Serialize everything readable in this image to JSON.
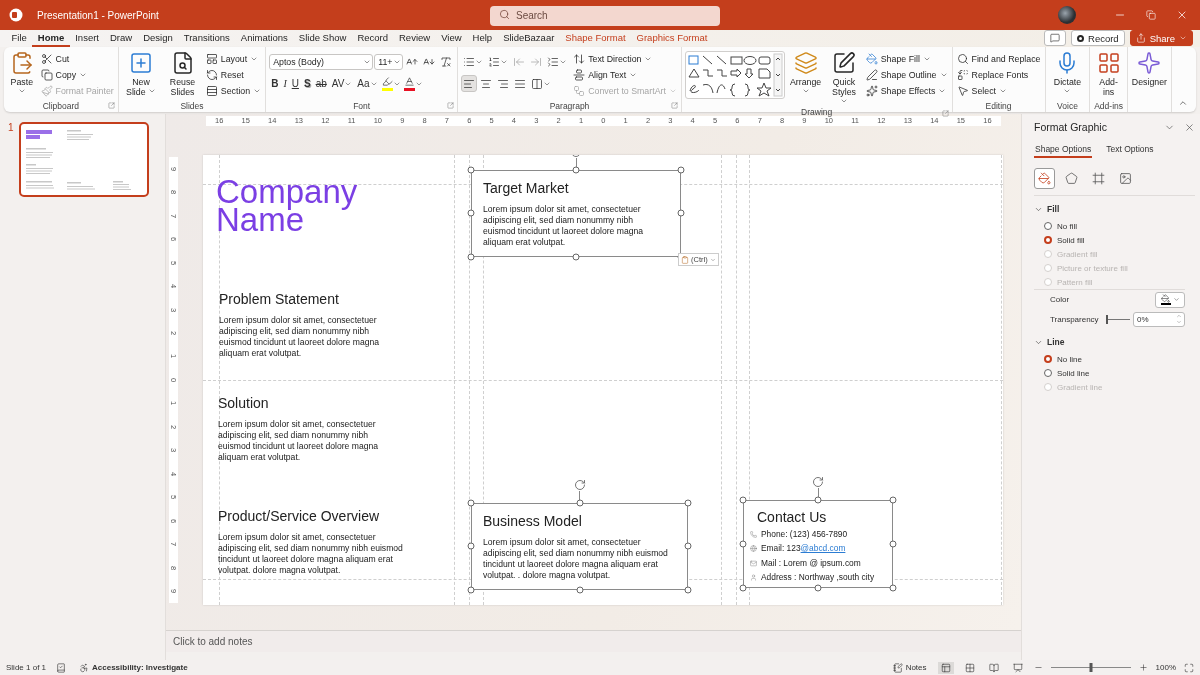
{
  "window": {
    "title": "Presentation1 - PowerPoint",
    "search_placeholder": "Search"
  },
  "ribbon_tabs": [
    {
      "label": "File",
      "selected": false,
      "kind": "normal"
    },
    {
      "label": "Home",
      "selected": true,
      "kind": "normal"
    },
    {
      "label": "Insert",
      "selected": false,
      "kind": "normal"
    },
    {
      "label": "Draw",
      "selected": false,
      "kind": "normal"
    },
    {
      "label": "Design",
      "selected": false,
      "kind": "normal"
    },
    {
      "label": "Transitions",
      "selected": false,
      "kind": "normal"
    },
    {
      "label": "Animations",
      "selected": false,
      "kind": "normal"
    },
    {
      "label": "Slide Show",
      "selected": false,
      "kind": "normal"
    },
    {
      "label": "Record",
      "selected": false,
      "kind": "normal"
    },
    {
      "label": "Review",
      "selected": false,
      "kind": "normal"
    },
    {
      "label": "View",
      "selected": false,
      "kind": "normal"
    },
    {
      "label": "Help",
      "selected": false,
      "kind": "normal"
    },
    {
      "label": "SlideBazaar",
      "selected": false,
      "kind": "normal"
    },
    {
      "label": "Shape Format",
      "selected": false,
      "kind": "contextual"
    },
    {
      "label": "Graphics Format",
      "selected": false,
      "kind": "contextual"
    }
  ],
  "ribbon_actions": [
    {
      "kind": "comments"
    },
    {
      "kind": "record",
      "label": "Record"
    },
    {
      "kind": "share",
      "label": "Share"
    }
  ],
  "ribbon_groups": [
    {
      "label": "Clipboard",
      "launcher": true,
      "blocks": [
        {
          "kind": "stack",
          "items": [
            {
              "kind": "large",
              "label": "Paste",
              "caret": true
            }
          ]
        },
        {
          "kind": "stack",
          "items": [
            {
              "kind": "small",
              "label": "Cut"
            },
            {
              "kind": "small",
              "label": "Copy",
              "caret": true
            },
            {
              "kind": "small",
              "label": "Format Painter",
              "disabled": true
            }
          ]
        }
      ]
    },
    {
      "label": "Slides",
      "blocks": [
        {
          "kind": "stack",
          "items": [
            {
              "kind": "large",
              "label": "New Slide",
              "caret": true
            }
          ]
        },
        {
          "kind": "stack",
          "items": [
            {
              "kind": "large",
              "label": "Reuse Slides"
            }
          ]
        },
        {
          "kind": "stack",
          "items": [
            {
              "kind": "small",
              "label": "Layout",
              "caret": true
            },
            {
              "kind": "small",
              "label": "Reset"
            },
            {
              "kind": "small",
              "label": "Section",
              "caret": true
            }
          ]
        }
      ]
    },
    {
      "label": "Font",
      "launcher": true,
      "blocks": [
        {
          "kind": "toolbars",
          "bars": [
            {
              "items": [
                {
                  "kind": "select",
                  "value": "Aptos (Body)"
                },
                {
                  "kind": "select",
                  "value": "11+"
                },
                {
                  "kind": "icon"
                },
                {
                  "kind": "icon"
                },
                {
                  "kind": "icon"
                }
              ]
            },
            {
              "items": [
                {
                  "kind": "glyph",
                  "label": "B"
                },
                {
                  "kind": "glyph",
                  "label": "I"
                },
                {
                  "kind": "glyph",
                  "label": "U"
                },
                {
                  "kind": "glyph",
                  "label": "S"
                },
                {
                  "kind": "glyph",
                  "label": "ab"
                },
                {
                  "kind": "glyph",
                  "label": "AV",
                  "caret": true
                },
                {
                  "kind": "glyph",
                  "label": "Aa",
                  "caret": true
                },
                {
                  "kind": "color",
                  "color": "#ffff00",
                  "caret": true
                },
                {
                  "kind": "color",
                  "color": "#e81123",
                  "caret": true
                }
              ]
            }
          ]
        }
      ]
    },
    {
      "label": "Paragraph",
      "launcher": true,
      "blocks": [
        {
          "kind": "toolbars",
          "bars": [
            {
              "items": [
                {
                  "kind": "icon",
                  "caret": true
                },
                {
                  "kind": "icon",
                  "caret": true
                },
                {
                  "kind": "icon",
                  "disabled": true
                },
                {
                  "kind": "icon",
                  "disabled": true
                },
                {
                  "kind": "icon",
                  "caret": true
                }
              ]
            },
            {
              "items": [
                {
                  "kind": "icon",
                  "selected": true
                },
                {
                  "kind": "icon",
                  "selected": false
                },
                {
                  "kind": "icon",
                  "selected": false
                },
                {
                  "kind": "icon",
                  "selected": false
                },
                {
                  "kind": "icon",
                  "caret": true
                }
              ]
            }
          ]
        },
        {
          "kind": "stack",
          "items": [
            {
              "kind": "small",
              "label": "Text Direction",
              "caret": true
            },
            {
              "kind": "small",
              "label": "Align Text",
              "caret": true
            },
            {
              "kind": "small",
              "label": "Convert to SmartArt",
              "caret": true,
              "disabled": true
            }
          ]
        }
      ]
    },
    {
      "label": "Drawing",
      "launcher": true,
      "blocks": [
        {
          "kind": "gallery"
        },
        {
          "kind": "stack",
          "items": [
            {
              "kind": "large",
              "label": "Arrange",
              "caret": true
            }
          ]
        },
        {
          "kind": "stack",
          "items": [
            {
              "kind": "large",
              "label": "Quick Styles",
              "caret": true
            }
          ]
        },
        {
          "kind": "stack",
          "items": [
            {
              "kind": "small",
              "label": "Shape Fill",
              "caret": true
            },
            {
              "kind": "small",
              "label": "Shape Outline",
              "caret": true
            },
            {
              "kind": "small",
              "label": "Shape Effects",
              "caret": true
            }
          ]
        }
      ]
    },
    {
      "label": "Editing",
      "blocks": [
        {
          "kind": "stack",
          "items": [
            {
              "kind": "small",
              "label": "Find and Replace"
            },
            {
              "kind": "small",
              "label": "Replace Fonts"
            },
            {
              "kind": "small",
              "label": "Select",
              "caret": true
            }
          ]
        }
      ]
    },
    {
      "label": "Voice",
      "blocks": [
        {
          "kind": "stack",
          "items": [
            {
              "kind": "large",
              "label": "Dictate",
              "caret": true
            }
          ]
        }
      ]
    },
    {
      "label": "Add-ins",
      "blocks": [
        {
          "kind": "stack",
          "items": [
            {
              "kind": "large",
              "label": "Add-ins"
            }
          ]
        }
      ]
    },
    {
      "blocks": [
        {
          "kind": "stack",
          "items": [
            {
              "kind": "large",
              "label": "Designer"
            }
          ]
        }
      ]
    }
  ],
  "thumbnails": [
    {
      "number": "1",
      "selected": true
    }
  ],
  "rulers": {
    "horizontal": [
      "16",
      "15",
      "14",
      "13",
      "12",
      "11",
      "10",
      "9",
      "8",
      "7",
      "6",
      "5",
      "4",
      "3",
      "2",
      "1",
      "0",
      "1",
      "2",
      "3",
      "4",
      "5",
      "6",
      "7",
      "8",
      "9",
      "10",
      "11",
      "12",
      "13",
      "14",
      "15",
      "16"
    ],
    "vertical": [
      "9",
      "8",
      "7",
      "6",
      "5",
      "4",
      "3",
      "2",
      "1",
      "0",
      "1",
      "2",
      "3",
      "4",
      "5",
      "6",
      "7",
      "8",
      "9"
    ]
  },
  "slide": {
    "shapes": [
      {
        "kind": "title",
        "text": "Company Name",
        "selected": false
      },
      {
        "kind": "section",
        "heading": "Target Market",
        "body": "Lorem ipsum dolor sit amet, consectetuer adipiscing elit, sed diam nonummy nibh euismod tincidunt ut laoreet dolore magna aliquam erat volutpat.",
        "selected": true
      },
      {
        "kind": "section",
        "heading": "Problem Statement",
        "body": "Lorem ipsum dolor sit amet, consectetuer adipiscing elit, sed diam nonummy nibh euismod tincidunt ut laoreet dolore magna aliquam erat volutpat.",
        "selected": false
      },
      {
        "kind": "section",
        "heading": "Solution",
        "body": "Lorem ipsum dolor sit amet, consectetuer adipiscing elit, sed diam nonummy nibh euismod tincidunt ut laoreet dolore magna aliquam erat volutpat.",
        "selected": false
      },
      {
        "kind": "section",
        "heading": "Product/Service Overview",
        "body": "Lorem ipsum dolor sit amet, consectetuer adipiscing elit, sed diam nonummy nibh euismod tincidunt ut laoreet dolore magna aliquam erat volutpat. dolore magna volutpat.",
        "selected": false
      },
      {
        "kind": "section",
        "heading": "Business Model",
        "body": "Lorem ipsum dolor sit amet, consectetuer adipiscing elit, sed diam nonummy nibh euismod tincidunt ut laoreet dolore magna aliquam erat volutpat. . dolore magna volutpat.",
        "selected": true
      },
      {
        "kind": "contact",
        "heading": "Contact Us",
        "selected": true,
        "lines": [
          {
            "text": "Phone: (123) 456-7890"
          },
          {
            "text": "Email: 123",
            "link": "@abcd.com"
          },
          {
            "text": "Mail : Lorem @ ipsum.com"
          },
          {
            "text": "Address : Northway ,south city"
          }
        ]
      }
    ],
    "paste_options": {
      "label": "(Ctrl)"
    }
  },
  "notes": {
    "placeholder": "Click to add notes"
  },
  "format_pane": {
    "title": "Format Graphic",
    "tabs": [
      {
        "label": "Shape Options",
        "selected": true
      },
      {
        "label": "Text Options",
        "selected": false
      }
    ],
    "icon_tabs": [
      {
        "selected": true
      },
      {
        "selected": false
      },
      {
        "selected": false
      },
      {
        "selected": false
      }
    ],
    "sections": [
      {
        "label": "Fill",
        "expanded": true,
        "options": [
          {
            "label": "No fill",
            "selected": false,
            "disabled": false
          },
          {
            "label": "Solid fill",
            "selected": true,
            "disabled": false
          },
          {
            "label": "Gradient fill",
            "selected": false,
            "disabled": true
          },
          {
            "label": "Picture or texture fill",
            "selected": false,
            "disabled": true
          },
          {
            "label": "Pattern fill",
            "selected": false,
            "disabled": true
          }
        ],
        "settings": [
          {
            "kind": "color",
            "label": "Color"
          },
          {
            "kind": "slider",
            "label": "Transparency",
            "level": 0,
            "value": "0%"
          }
        ]
      },
      {
        "label": "Line",
        "expanded": true,
        "options": [
          {
            "label": "No line",
            "selected": true,
            "disabled": false
          },
          {
            "label": "Solid line",
            "selected": false,
            "disabled": false
          },
          {
            "label": "Gradient line",
            "selected": false,
            "disabled": true
          }
        ]
      }
    ]
  },
  "status_bar": {
    "slide_info": "Slide 1 of 1",
    "accessibility": "Accessibility: Investigate",
    "notes_label": "Notes",
    "views": [
      {
        "selected": true
      },
      {
        "selected": false
      },
      {
        "selected": false
      },
      {
        "selected": false
      }
    ],
    "zoom": {
      "level": 0.5,
      "value": "100%"
    }
  }
}
